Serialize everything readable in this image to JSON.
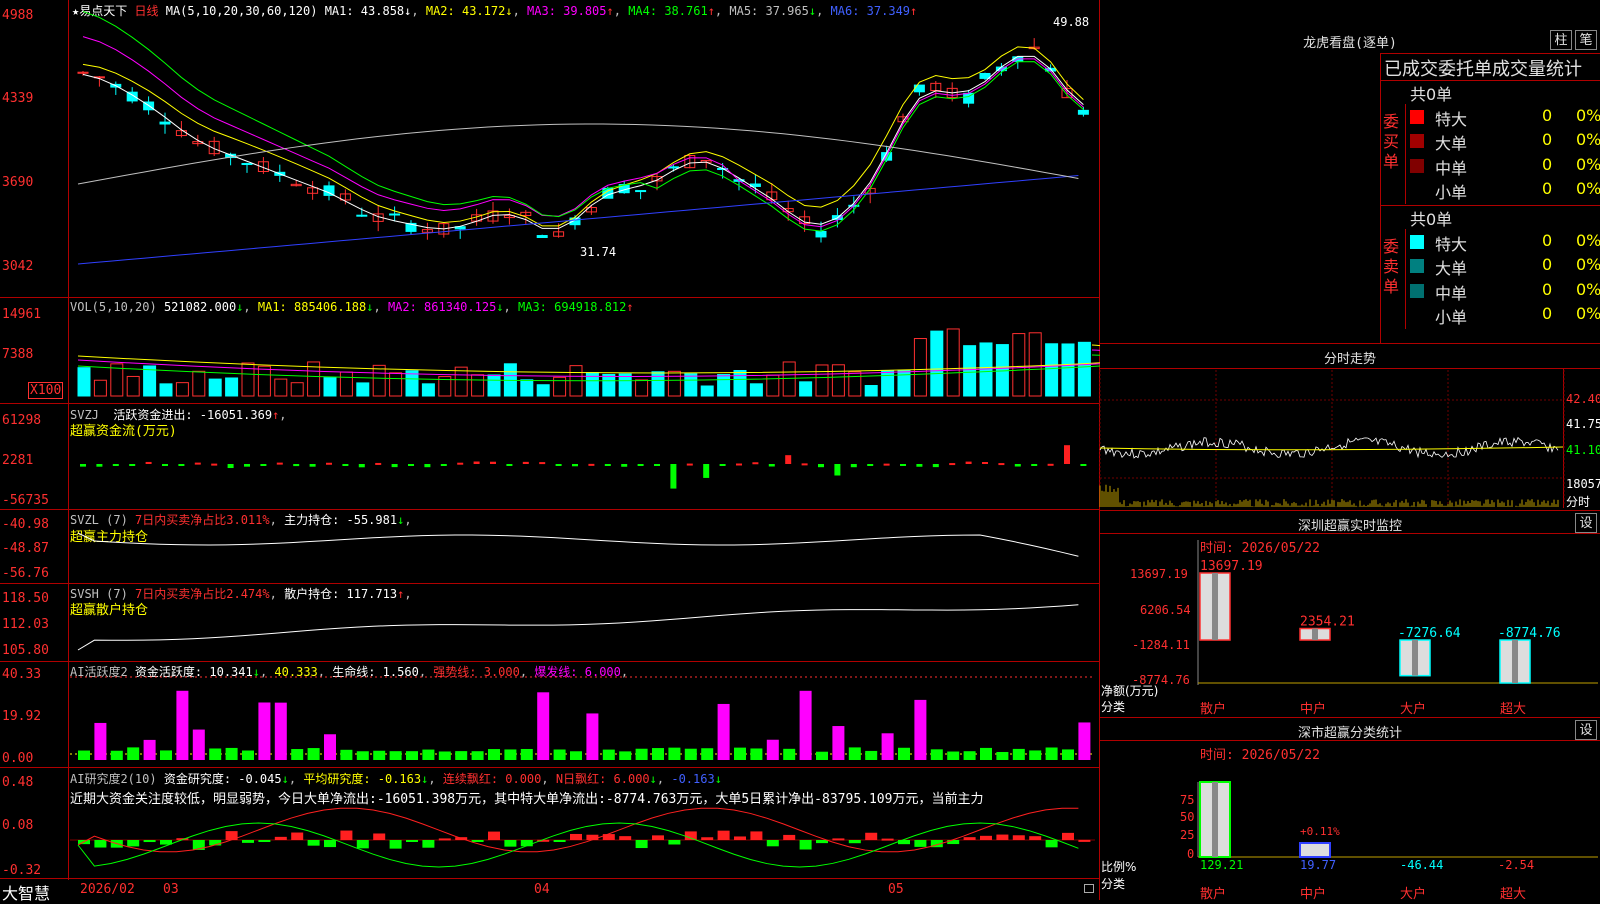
{
  "kline": {
    "name": "易点天下",
    "period": "日线",
    "ma_label": "MA(5,10,20,30,60,120)",
    "ma1": "MA1: 43.858",
    "ma2": "MA2: 43.172",
    "ma3": "MA3: 39.805",
    "ma4": "MA4: 38.761",
    "ma5": "MA5: 37.965",
    "ma6": "MA6: 37.349",
    "arrows": {
      "ma1": "↓",
      "ma2": "↓",
      "ma3": "↑",
      "ma4": "↑",
      "ma5": "↓",
      "ma6": "↑"
    },
    "high_mark": "49.88",
    "low_mark": "31.74",
    "y_ticks": [
      "4988",
      "4339",
      "3690",
      "3042"
    ]
  },
  "vol": {
    "label": "VOL(5,10,20)",
    "value": "521082.000",
    "ma1": "MA1: 885406.188",
    "ma2": "MA2: 861340.125",
    "ma3": "MA3: 694918.812",
    "y_ticks": [
      "14961",
      "7388"
    ],
    "unit": "X100"
  },
  "svzj": {
    "label": "SVZJ",
    "item": "活跃资金进出: -16051.369",
    "sub": "超赢资金流(万元)",
    "y_ticks": [
      "61298",
      "2281",
      "-56735"
    ]
  },
  "svzl": {
    "label": "SVZL (7)",
    "item1": "7日内买卖净占比3.011%",
    "item2": "主力持仓: -55.981",
    "sub": "超赢主力持仓",
    "y_ticks": [
      "-40.98",
      "-48.87",
      "-56.76"
    ]
  },
  "svsh": {
    "label": "SVSH (7)",
    "item1": "7日内买卖净占比2.474%",
    "item2": "散户持仓: 117.713",
    "sub": "超赢散户持仓",
    "y_ticks": [
      "118.50",
      "112.03",
      "105.80"
    ]
  },
  "ai1": {
    "label": "AI活跃度2",
    "item1": "资金活跃度: 10.341",
    "item2": "40.333",
    "item3": "生命线: 1.560",
    "item4": "强势线: 3.000",
    "item5": "爆发线: 6.000",
    "y_ticks": [
      "40.33",
      "19.92",
      "0.00"
    ]
  },
  "ai2": {
    "label": "AI研究度2(10)",
    "item1": "资金研究度: -0.045",
    "item2": "平均研究度: -0.163",
    "item3": "连续飘红: 0.000",
    "item4": "N日飘红: 6.000",
    "item5": "-0.163",
    "text": "近期大资金关注度较低，明显弱势，今日大单净流出:-16051.398万元，其中特大单净流出:-8774.763万元，大单5日累计净出-83795.109万元，当前主力",
    "y_ticks": [
      "0.48",
      "0.08",
      "-0.32"
    ]
  },
  "footer": {
    "brand": "大智慧",
    "dates": [
      "2026/02",
      "03",
      "04",
      "05"
    ]
  },
  "right": {
    "title": "龙虎看盘(逐单)",
    "btn_zhu": "柱",
    "btn_bi": "笔",
    "table_title": "已成交委托单成交量统计",
    "buy": {
      "label": "委买单",
      "total": "共0单",
      "rows": [
        {
          "name": "特大",
          "n": "0",
          "p": "0%"
        },
        {
          "name": "大单",
          "n": "0",
          "p": "0%"
        },
        {
          "name": "中单",
          "n": "0",
          "p": "0%"
        },
        {
          "name": "小单",
          "n": "0",
          "p": "0%"
        }
      ]
    },
    "sell": {
      "label": "委卖单",
      "total": "共0单",
      "rows": [
        {
          "name": "特大",
          "n": "0",
          "p": "0%"
        },
        {
          "name": "大单",
          "n": "0",
          "p": "0%"
        },
        {
          "name": "中单",
          "n": "0",
          "p": "0%"
        },
        {
          "name": "小单",
          "n": "0",
          "p": "0%"
        }
      ]
    },
    "minute_title": "分时走势",
    "minute_ticks": [
      "42.40",
      "41.75",
      "41.10",
      "18057"
    ],
    "minute_unit": "分时",
    "sz_title": "深圳超赢实时监控",
    "sz_time": "时间: 2026/05/22",
    "sz_ticks": [
      "13697.19",
      "6206.54",
      "-1284.11",
      "-8774.76"
    ],
    "sz_values": [
      "13697.19",
      "2354.21",
      "-7276.64",
      "-8774.76"
    ],
    "sz_ylabel": "净额(万元)",
    "sz_xlabel": "分类",
    "sz_cats": [
      "散户",
      "中户",
      "大户",
      "超大"
    ],
    "sm_title": "深市超赢分类统计",
    "sm_time": "时间: 2026/05/22",
    "sm_ticks": [
      "75",
      "50",
      "25",
      "0"
    ],
    "sm_values": [
      "129.21",
      "19.77",
      "-46.44",
      "-2.54"
    ],
    "sm_extra": "+0.11%",
    "sm_ylabel": "比例%",
    "sm_xlabel": "分类",
    "sm_cats": [
      "散户",
      "中户",
      "大户",
      "超大"
    ],
    "set_btn": "设"
  },
  "chart_data": {
    "type": "bar",
    "title": "深圳超赢实时监控",
    "categories": [
      "散户",
      "中户",
      "大户",
      "超大"
    ],
    "values": [
      13697.19,
      2354.21,
      -7276.64,
      -8774.76
    ],
    "ylabel": "净额(万元)",
    "xlabel": "分类",
    "ylim": [
      -8774.76,
      13697.19
    ]
  }
}
